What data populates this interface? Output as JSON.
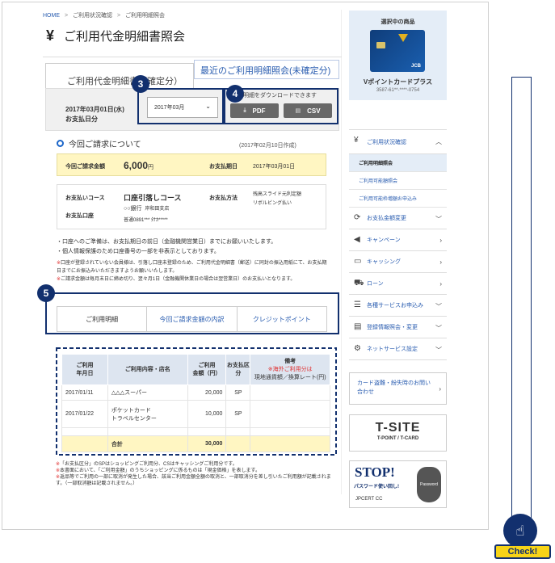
{
  "breadcrumb": {
    "home": "HOME",
    "sep": ">",
    "item1": "ご利用状況確認",
    "item2": "ご利用明細照会"
  },
  "page": {
    "icon": "¥",
    "title": "ご利用代金明細書照会"
  },
  "tabs": {
    "confirmed": "ご利用代金明細書（確定分）",
    "recent": "最近のご利用明細照会(未確定分)"
  },
  "statement": {
    "date_line1": "2017年03月01日(水)",
    "date_line2": "お支払日分",
    "month_select": "2017年03月",
    "download_note": "明細をダウンロードできます",
    "pdf_label": "PDF",
    "csv_label": "CSV"
  },
  "badges": {
    "b3": "3",
    "b4": "4",
    "b5": "5"
  },
  "billing": {
    "section_title": "今回ご請求について",
    "created": "(2017年02月10日作成)",
    "amount_label": "今回ご請求金額",
    "amount_value": "6,000",
    "amount_unit": "円",
    "pay_date_label": "お支払期日",
    "pay_date_value": "2017年03月01日",
    "course_label": "お支払いコース",
    "course_value": "口座引落しコース",
    "bank_name": "○○銀行",
    "branch": "岸和田支店",
    "account_label": "お支払口座",
    "account_value": "普通0891***  ﾀﾅｶ*****",
    "method_label": "お支払方法",
    "method_line1": "残高スライド元利定額",
    "method_line2": "リボルビング払い"
  },
  "notes": {
    "n1": "・口座へのご準備は、お支払期日の前日（金融機関営業日）までにお願いいたします。",
    "n2": "・個人情報保護のため口座番号の一部を非表示としております。",
    "r1": "口座が登録されていない会員様は、引落し口座未登録のため、ご利用代金明細書（郵送）に同封の振込用紙にて、お支払期日までにお振込みいただきますようお願いいたします。",
    "r2": "ご請求金額は毎月末日に締め切り、翌々月1日（金融機関休業日の場合は翌営業日）のお支払いとなります。",
    "mark": "※"
  },
  "detail_tabs": [
    "ご利用明細",
    "今回ご請求金額の内訳",
    "クレジットポイント"
  ],
  "table": {
    "headers": {
      "date": [
        "ご利用",
        "年月日"
      ],
      "shop": "ご利用内容・店名",
      "amount": [
        "ご利用",
        "金額（円）"
      ],
      "type": [
        "お支払区",
        "分"
      ],
      "remarks_title": "備考",
      "remarks_red": "※海外ご利用分は",
      "remarks_sub": "現地通貨額／換算レート(円)"
    },
    "rows": [
      {
        "date": "2017/01/11",
        "shop1": "△△△スーパー",
        "shop2": "",
        "amount": "20,000",
        "type": "SP"
      },
      {
        "date": "2017/01/22",
        "shop1": "ポケットカード",
        "shop2": "トラベルセンター",
        "amount": "10,000",
        "type": "SP"
      }
    ],
    "total_label": "合計",
    "total_value": "30,000"
  },
  "footnotes": {
    "f1": "「お支払区分」のSPはショッピングご利用分、CSはキャッシングご利用分です。",
    "f2": "本書面において、「ご利用金額」のうちショッピングに係るものは「現金価格」を表します。",
    "f3": "返品等でご利用の一部に取消が発生した場合、該当ご利用金額全額の取消と、一部取消分を差し引いたご利用額が記載されます。（一部取消額は記載されません。）"
  },
  "card": {
    "label": "選択中の商品",
    "name": "Vポイントカードプラス",
    "number": "3587-61**-****-0754",
    "brand": "JCB"
  },
  "sidenav": {
    "usage": "ご利用状況確認",
    "sub1": "ご利用明細照会",
    "sub2": "ご利用可能額照会",
    "sub3": "ご利用可能枠増額お申込み",
    "items": [
      "お支払金額変更",
      "キャンペーン",
      "キャッシング",
      "ローン",
      "各種サービスお申込み",
      "登録情報照会・変更",
      "ネットサービス設定"
    ]
  },
  "lost_card": "カード盗難・紛失時のお問い合わせ",
  "tsite": {
    "logo": "T-SITE",
    "sub": "T-POINT / T-CARD"
  },
  "stop_banner": {
    "title": "STOP!",
    "sub": "パスワード使い回し!",
    "org": "JPCERT CC",
    "hand": "Password"
  },
  "check_label": "Check!"
}
